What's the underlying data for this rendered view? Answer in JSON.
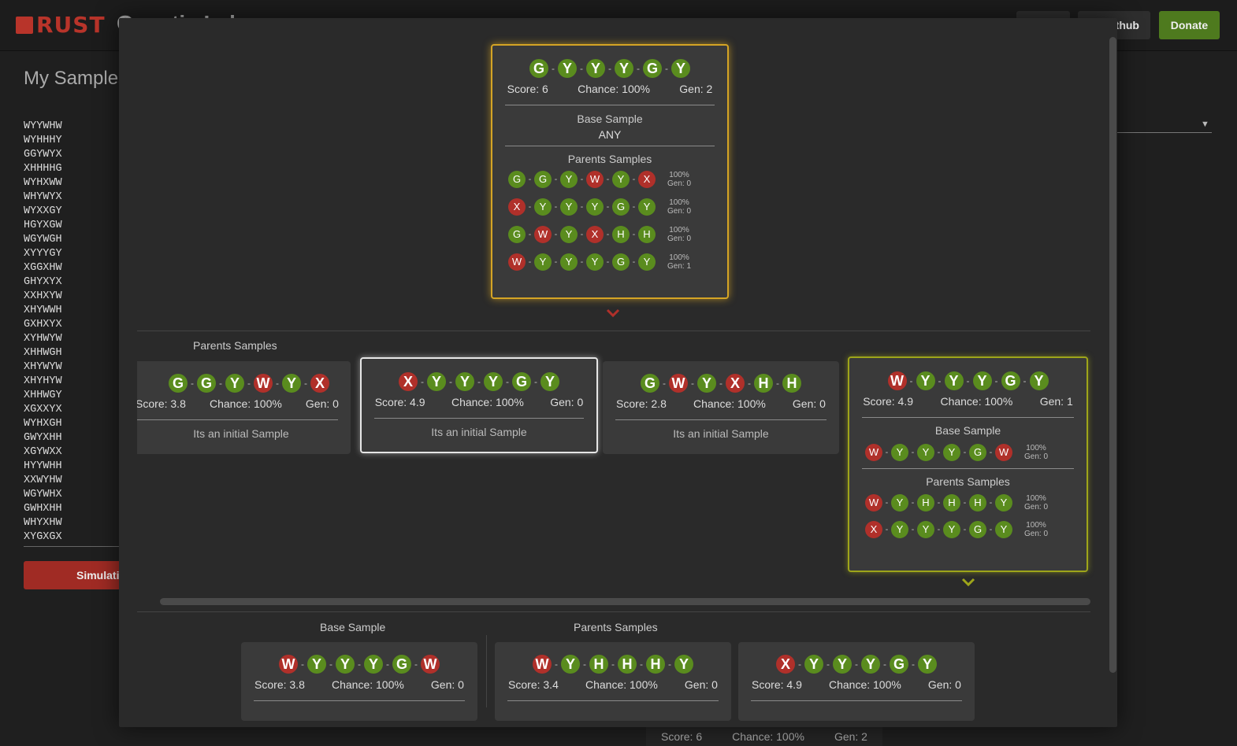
{
  "app": {
    "logo": "RUST",
    "title": "Genetic Lab",
    "nav_github": "Github",
    "donate": "Donate"
  },
  "background": {
    "heading": "My Samples",
    "samples": [
      "WYYWHW",
      "WYHHHY",
      "GGYWYX",
      "XHHHHG",
      "WYHXWW",
      "WHYWYX",
      "WYXXGY",
      "HGYXGW",
      "WGYWGH",
      "XYYYGY",
      "XGGXHW",
      "GHYXYX",
      "XXHXYW",
      "XHYWWH",
      "GXHXYX",
      "XYHWYW",
      "XHHWGH",
      "XHYWYW",
      "XHYHYW",
      "XHHWGY",
      "XGXXYX",
      "WYHXGH",
      "GWYXHH",
      "XGYWXX",
      "HYYWHH",
      "XXWYHW",
      "WGYWHX",
      "GWHXHH",
      "WHYXHW",
      "XYGXGX"
    ],
    "simulate_button": "Simulation",
    "peek_stats": {
      "score": "Score: 6",
      "chance": "Chance: 100%",
      "gen": "Gen: 2"
    }
  },
  "modal": {
    "root": {
      "genes": [
        "G",
        "Y",
        "Y",
        "Y",
        "G",
        "Y"
      ],
      "score": "Score: 6",
      "chance": "Chance: 100%",
      "gen": "Gen: 2",
      "base_title": "Base Sample",
      "base_value": "ANY",
      "parents_title": "Parents Samples",
      "parents": [
        {
          "genes": [
            "G",
            "G",
            "Y",
            "W",
            "Y",
            "X"
          ],
          "chance": "100%",
          "gen": "Gen: 0"
        },
        {
          "genes": [
            "X",
            "Y",
            "Y",
            "Y",
            "G",
            "Y"
          ],
          "chance": "100%",
          "gen": "Gen: 0"
        },
        {
          "genes": [
            "G",
            "W",
            "Y",
            "X",
            "H",
            "H"
          ],
          "chance": "100%",
          "gen": "Gen: 0"
        },
        {
          "genes": [
            "W",
            "Y",
            "Y",
            "Y",
            "G",
            "Y"
          ],
          "chance": "100%",
          "gen": "Gen: 1"
        }
      ]
    },
    "level1": {
      "label": "Parents Samples",
      "cards": [
        {
          "genes": [
            "G",
            "G",
            "Y",
            "W",
            "Y",
            "X"
          ],
          "score": "Score: 3.8",
          "chance": "Chance: 100%",
          "gen": "Gen: 0",
          "note": "Its an initial Sample"
        },
        {
          "genes": [
            "X",
            "Y",
            "Y",
            "Y",
            "G",
            "Y"
          ],
          "score": "Score: 4.9",
          "chance": "Chance: 100%",
          "gen": "Gen: 0",
          "note": "Its an initial Sample"
        },
        {
          "genes": [
            "G",
            "W",
            "Y",
            "X",
            "H",
            "H"
          ],
          "score": "Score: 2.8",
          "chance": "Chance: 100%",
          "gen": "Gen: 0",
          "note": "Its an initial Sample"
        },
        {
          "genes": [
            "W",
            "Y",
            "Y",
            "Y",
            "G",
            "Y"
          ],
          "score": "Score: 4.9",
          "chance": "Chance: 100%",
          "gen": "Gen: 1",
          "base_title": "Base Sample",
          "base": {
            "genes": [
              "W",
              "Y",
              "Y",
              "Y",
              "G",
              "W"
            ],
            "chance": "100%",
            "gen": "Gen: 0"
          },
          "parents_title": "Parents Samples",
          "parents": [
            {
              "genes": [
                "W",
                "Y",
                "H",
                "H",
                "H",
                "Y"
              ],
              "chance": "100%",
              "gen": "Gen: 0"
            },
            {
              "genes": [
                "X",
                "Y",
                "Y",
                "Y",
                "G",
                "Y"
              ],
              "chance": "100%",
              "gen": "Gen: 0"
            }
          ]
        }
      ]
    },
    "level2": {
      "base_label": "Base Sample",
      "parents_label": "Parents Samples",
      "base_card": {
        "genes": [
          "W",
          "Y",
          "Y",
          "Y",
          "G",
          "W"
        ],
        "score": "Score: 3.8",
        "chance": "Chance: 100%",
        "gen": "Gen: 0"
      },
      "parent_cards": [
        {
          "genes": [
            "W",
            "Y",
            "H",
            "H",
            "H",
            "Y"
          ],
          "score": "Score: 3.4",
          "chance": "Chance: 100%",
          "gen": "Gen: 0"
        },
        {
          "genes": [
            "X",
            "Y",
            "Y",
            "Y",
            "G",
            "Y"
          ],
          "score": "Score: 4.9",
          "chance": "Chance: 100%",
          "gen": "Gen: 0"
        }
      ]
    },
    "colors": {
      "good_gene": "#5a8c1e",
      "bad_gene": "#b0302a",
      "root_border": "#d4a425",
      "olive_border": "#9ea51a",
      "accent_red": "#a02b24"
    }
  }
}
